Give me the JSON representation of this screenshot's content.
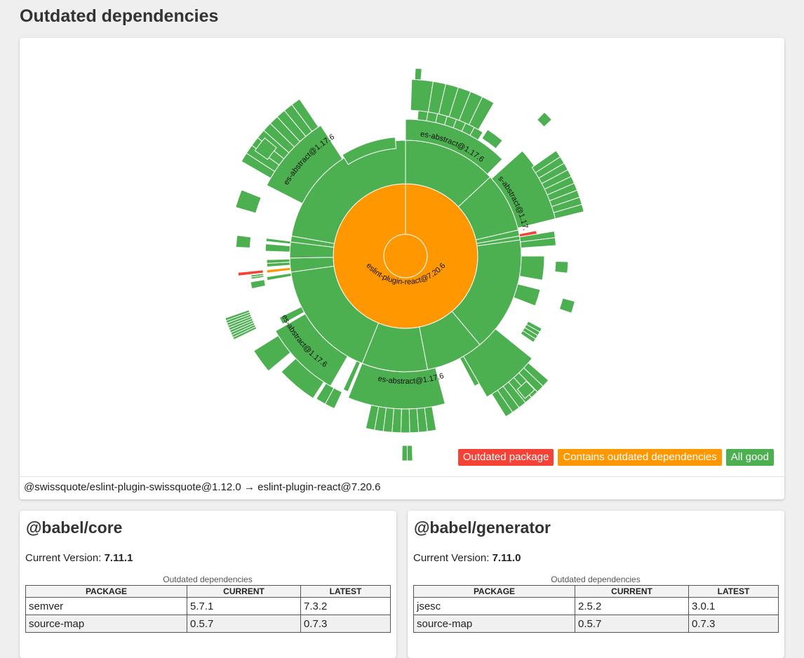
{
  "page": {
    "title": "Outdated dependencies"
  },
  "sunburst": {
    "root_label": "eslint-plugin-react@7.20.6",
    "segment_label": "es-abstract@1.17.6",
    "colors": {
      "outdated": "#f44336",
      "contains_outdated": "#ff9800",
      "good": "#4caf50"
    }
  },
  "legend": {
    "outdated": "Outdated package",
    "contains_outdated": "Contains outdated dependencies",
    "good": "All good"
  },
  "breadcrumb": "@swissquote/eslint-plugin-swissquote@1.12.0 → eslint-plugin-react@7.20.6",
  "cards": [
    {
      "title": "@babel/core",
      "version_label": "Current Version:",
      "version": "7.11.1",
      "caption": "Outdated dependencies",
      "headers": [
        "PACKAGE",
        "CURRENT",
        "LATEST"
      ],
      "rows": [
        [
          "semver",
          "5.7.1",
          "7.3.2"
        ],
        [
          "source-map",
          "0.5.7",
          "0.7.3"
        ]
      ]
    },
    {
      "title": "@babel/generator",
      "version_label": "Current Version:",
      "version": "7.11.0",
      "caption": "Outdated dependencies",
      "headers": [
        "PACKAGE",
        "CURRENT",
        "LATEST"
      ],
      "rows": [
        [
          "jsesc",
          "2.5.2",
          "3.0.1"
        ],
        [
          "source-map",
          "0.5.7",
          "0.7.3"
        ]
      ]
    }
  ]
}
